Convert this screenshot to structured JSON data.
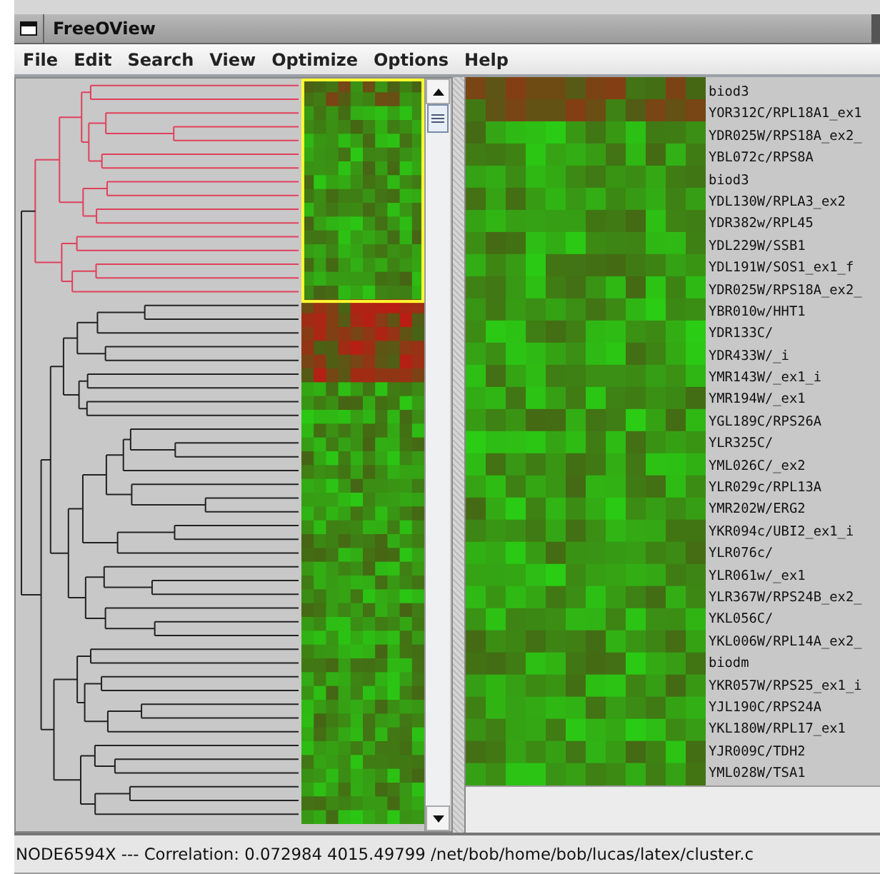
{
  "window": {
    "title": "FreeOView"
  },
  "menu": [
    "File",
    "Edit",
    "Search",
    "View",
    "Optimize",
    "Options",
    "Help"
  ],
  "gene_labels": [
    "biod3",
    "YOR312C/RPL18A1_ex1",
    "YDR025W/RPS18A_ex2_",
    "YBL072c/RPS8A",
    "biod3",
    "YDL130W/RPLA3_ex2",
    "YDR382w/RPL45",
    "YDL229W/SSB1",
    "YDL191W/SOS1_ex1_f",
    "YDR025W/RPS18A_ex2_",
    "YBR010w/HHT1",
    "YDR133C/",
    "YDR433W/_i",
    "YMR143W/_ex1_i",
    "YMR194W/_ex1",
    "YGL189C/RPS26A",
    "YLR325C/",
    "YML026C/_ex2",
    "YLR029c/RPL13A",
    "YMR202W/ERG2",
    "YKR094c/UBI2_ex1_i",
    "YLR076c/",
    "YLR061w/_ex1",
    "YLR367W/RPS24B_ex2_",
    "YKL056C/",
    "YKL006W/RPL14A_ex2_",
    "biodm",
    "YKR057W/RPS25_ex1_i",
    "YJL190C/RPS24A",
    "YKL180W/RPL17_ex1",
    "YJR009C/TDH2",
    "YML028W/TSA1"
  ],
  "status_bar": "NODE6594X --- Correlation: 0.072984 4015.49799 /net/bob/home/bob/lucas/latex/cluster.c"
}
